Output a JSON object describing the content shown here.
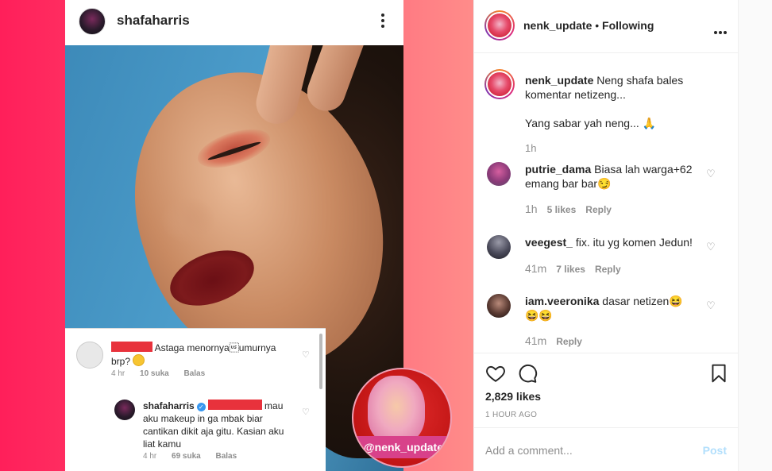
{
  "post_image": {
    "inner_header": {
      "username": "shafaharris"
    },
    "comment1": {
      "text": "Astaga menornya\u001fumurnya brp?",
      "time": "4 hr",
      "likes": "10 suka",
      "reply": "Balas"
    },
    "comment2": {
      "username": "shafaharris",
      "text": "mau aku makeup in ga mbak biar cantikan dikit aja gitu. Kasian aku liat kamu",
      "time": "4 hr",
      "likes": "69 suka",
      "reply": "Balas"
    },
    "badge_label": "@nenk_update"
  },
  "header": {
    "username": "nenk_update",
    "separator": " • ",
    "follow_status": "Following"
  },
  "caption": {
    "username": "nenk_update",
    "text": "Neng shafa bales komentar netizeng...",
    "text2": "Yang sabar yah neng... 🙏",
    "time": "1h"
  },
  "comments": [
    {
      "username": "putrie_dama",
      "text": "Biasa lah warga+62 emang bar bar😏",
      "time": "1h",
      "likes": "5 likes",
      "reply": "Reply"
    },
    {
      "username": "veegest_",
      "text": "fix. itu yg komen Jedun!",
      "time": "41m",
      "likes": "7 likes",
      "reply": "Reply"
    },
    {
      "username": "iam.veeronika",
      "text": "dasar netizen😆 😆😆",
      "time": "41m",
      "likes": "",
      "reply": "Reply"
    }
  ],
  "actions": {
    "likes": "2,829 likes",
    "ago": "1 HOUR AGO"
  },
  "add_comment": {
    "placeholder": "Add a comment...",
    "post_label": "Post"
  },
  "icons": [
    "more-icon",
    "heart-icon",
    "comment-icon",
    "bookmark-icon",
    "verified-icon",
    "pray-emoji",
    "smirk-emoji",
    "laugh-emoji"
  ],
  "colors": {
    "accent_pink": "#ff1f5a",
    "redaction": "#e8323c",
    "link_disabled": "#b2dffc",
    "text": "#262626",
    "muted": "#8e8e8e"
  }
}
